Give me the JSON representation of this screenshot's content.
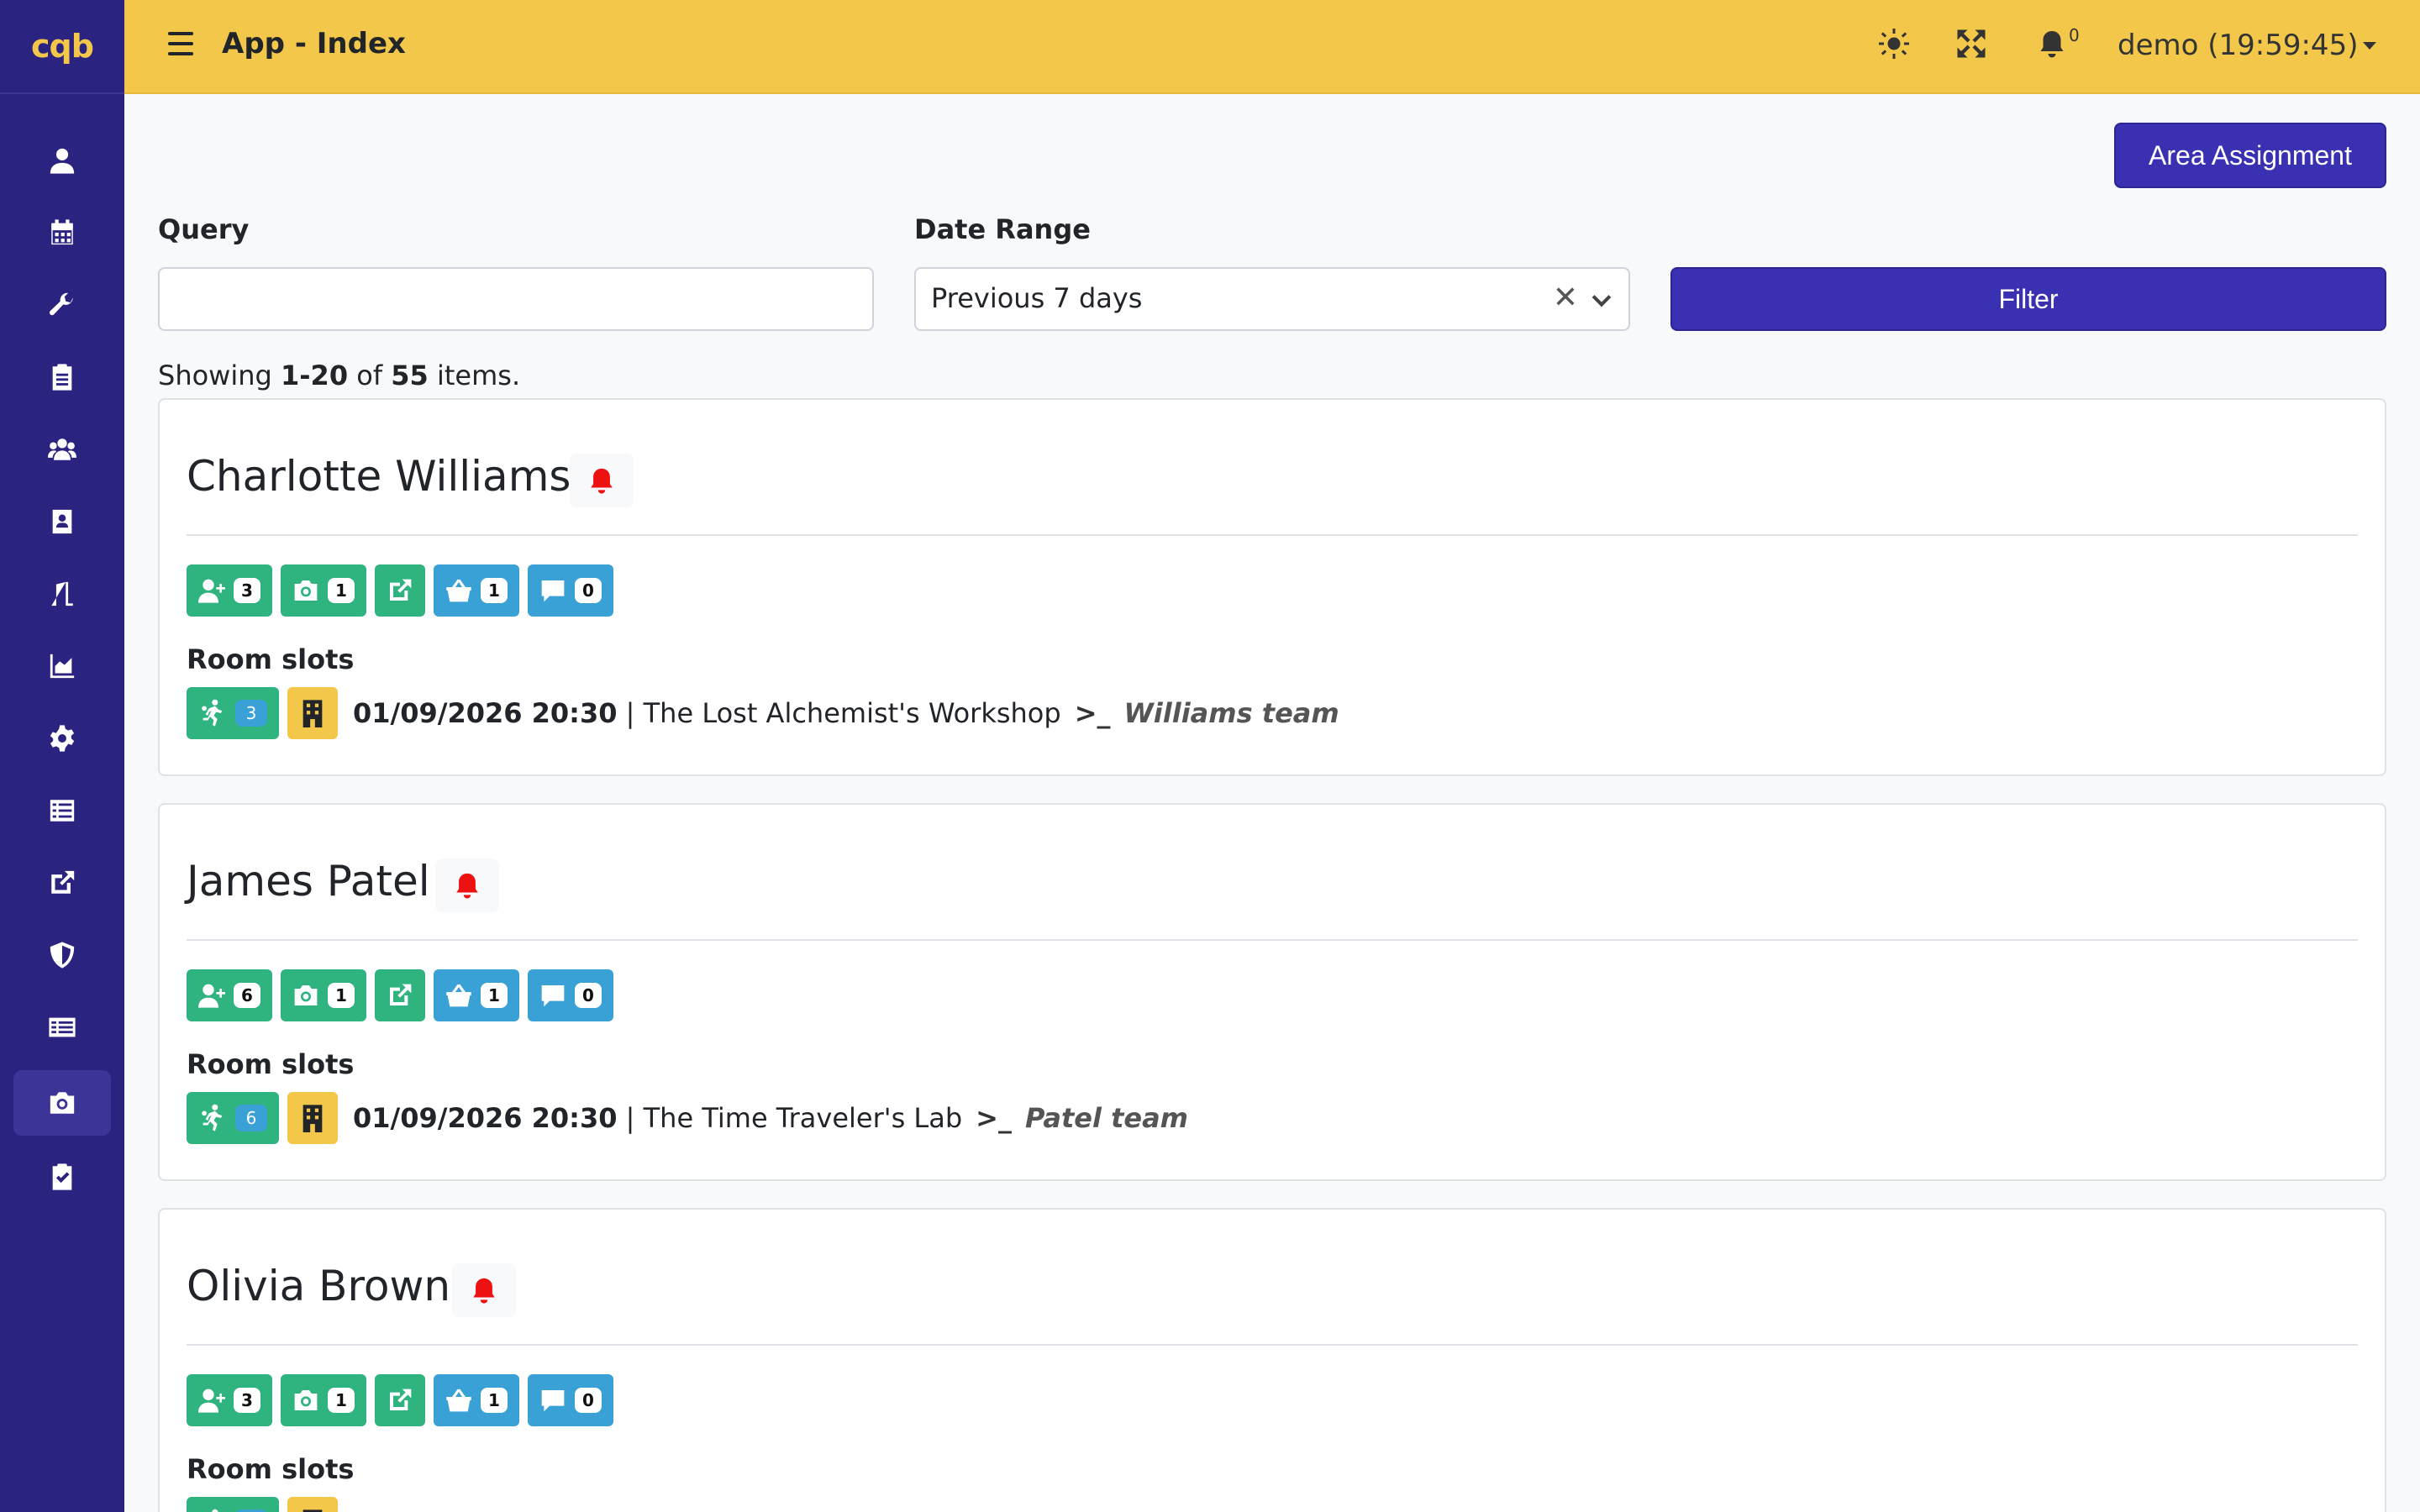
{
  "brand": {
    "logo_text": "cqb",
    "accent": "#f3c84a",
    "sidebar_bg": "#2b2380",
    "primary": "#3a31b2"
  },
  "topbar": {
    "title": "App - Index",
    "theme_icon": "sun-icon",
    "fullscreen_icon": "expand-icon",
    "notifications": {
      "icon": "bell-icon",
      "count": "0"
    },
    "user": "demo (19:59:45)"
  },
  "sidebar": {
    "items": [
      {
        "icon": "user-icon"
      },
      {
        "icon": "calendar-icon"
      },
      {
        "icon": "wrench-icon"
      },
      {
        "icon": "clipboard-icon"
      },
      {
        "icon": "users-icon"
      },
      {
        "icon": "contact-book-icon"
      },
      {
        "icon": "door-icon"
      },
      {
        "icon": "chart-area-icon"
      },
      {
        "icon": "gear-icon"
      },
      {
        "icon": "list-icon"
      },
      {
        "icon": "external-link-icon"
      },
      {
        "icon": "shield-icon"
      },
      {
        "icon": "table-list-icon"
      },
      {
        "icon": "camera-icon",
        "active": true
      },
      {
        "icon": "clipboard-check-icon"
      }
    ]
  },
  "toolbar": {
    "area_assignment_label": "Area Assignment"
  },
  "filters": {
    "query_label": "Query",
    "query_value": "",
    "date_range_label": "Date Range",
    "date_range_value": "Previous 7 days",
    "filter_label": "Filter"
  },
  "summary": {
    "prefix": "Showing ",
    "range": "1-20",
    "middle": " of ",
    "total": "55",
    "suffix": " items."
  },
  "cards": [
    {
      "name": "Charlotte Williams",
      "counts": {
        "players": "3",
        "photos": "1",
        "shop": "1",
        "comments": "0"
      },
      "section_label": "Room slots",
      "slot": {
        "player_count": "3",
        "datetime": "01/09/2026 20:30",
        "room": " | The Lost Alchemist's Workshop",
        "team": "Williams team"
      }
    },
    {
      "name": "James Patel",
      "counts": {
        "players": "6",
        "photos": "1",
        "shop": "1",
        "comments": "0"
      },
      "section_label": "Room slots",
      "slot": {
        "player_count": "6",
        "datetime": "01/09/2026 20:30",
        "room": " | The Time Traveler's Lab",
        "team": "Patel team"
      }
    },
    {
      "name": "Olivia Brown",
      "counts": {
        "players": "3",
        "photos": "1",
        "shop": "1",
        "comments": "0"
      },
      "section_label": "Room slots",
      "slot": {
        "player_count": "",
        "datetime": "",
        "room": "",
        "team": ""
      }
    }
  ]
}
